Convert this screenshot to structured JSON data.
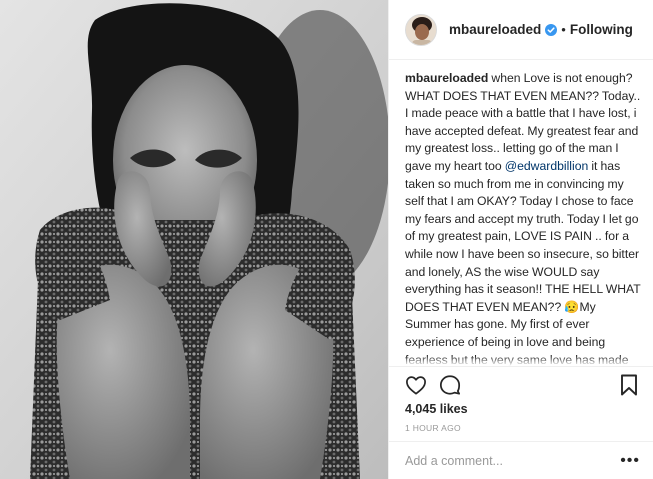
{
  "post": {
    "photo_alt": "Black and white portrait",
    "header": {
      "username": "mbaureloaded",
      "verified_icon": "verified-badge-icon",
      "separator": "•",
      "follow_status": "Following"
    },
    "caption": {
      "username": "mbaureloaded",
      "text_before_mention": "when Love is not enough? WHAT DOES THAT EVEN MEAN?? Today.. I made peace with a battle that I have lost, i have accepted defeat. My greatest fear and my greatest loss.. letting go of the man I gave my heart too ",
      "mention": "@edwardbillion",
      "text_after_mention": " it has taken so much from me in convincing my self that I am OKAY? Today I chose to face my fears and accept my truth. Today I let go of my greatest pain, LOVE IS PAIN .. for a while now I have been so insecure, so bitter and lonely, AS the wise WOULD say everything has it season!! THE HELL WHAT DOES THAT EVEN MEAN?? 😥My Summer has gone. My first of ever experience of being in love and being fearless but the very same love has made so small and so sore inside. I have lost me .. today I let go of my future plans, the man I saw as the father of my kids and my future husband.. and set him free🙏 ..."
    },
    "actions": {
      "like_icon": "heart-icon",
      "comment_icon": "comment-bubble-icon",
      "save_icon": "bookmark-icon"
    },
    "likes": "4,045 likes",
    "timestamp": "1 HOUR AGO",
    "comment": {
      "placeholder": "Add a comment...",
      "more_label": "•••"
    }
  },
  "colors": {
    "accent_blue": "#3897f0",
    "mention_blue": "#003569",
    "text": "#262626",
    "muted": "#999999",
    "border": "#efefef"
  }
}
